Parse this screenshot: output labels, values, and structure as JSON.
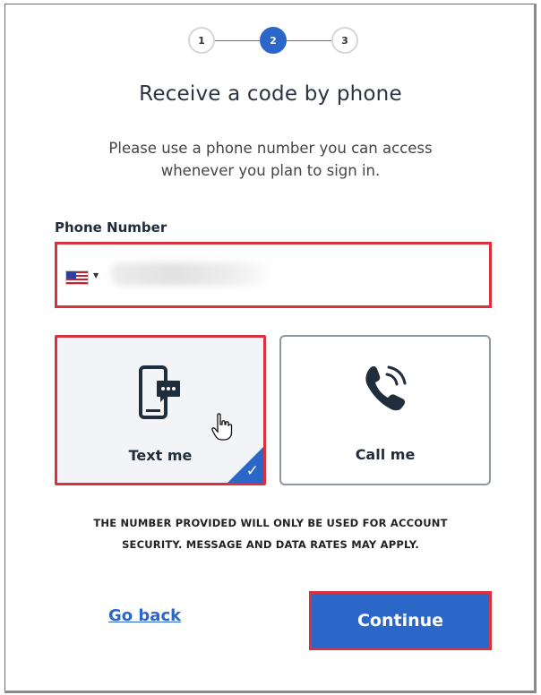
{
  "stepper": {
    "steps": [
      {
        "label": "1",
        "state": "idle"
      },
      {
        "label": "2",
        "state": "active"
      },
      {
        "label": "3",
        "state": "idle"
      }
    ]
  },
  "header": {
    "title": "Receive a code by phone",
    "subtitle_line1": "Please use a phone number you can access",
    "subtitle_line2": "whenever you plan to sign in."
  },
  "phone": {
    "label": "Phone Number",
    "country_flag_icon": "us-flag-icon",
    "value": ""
  },
  "methods": [
    {
      "id": "text",
      "label": "Text me",
      "icon": "phone-message-icon",
      "selected": true
    },
    {
      "id": "call",
      "label": "Call me",
      "icon": "phone-call-icon",
      "selected": false
    }
  ],
  "notice": {
    "line1": "THE NUMBER PROVIDED WILL ONLY BE USED FOR ACCOUNT",
    "line2": "SECURITY. MESSAGE AND DATA RATES MAY APPLY."
  },
  "actions": {
    "back_label": "Go back",
    "continue_label": "Continue"
  },
  "colors": {
    "accent": "#2b67c8",
    "highlight": "#d9323c"
  }
}
